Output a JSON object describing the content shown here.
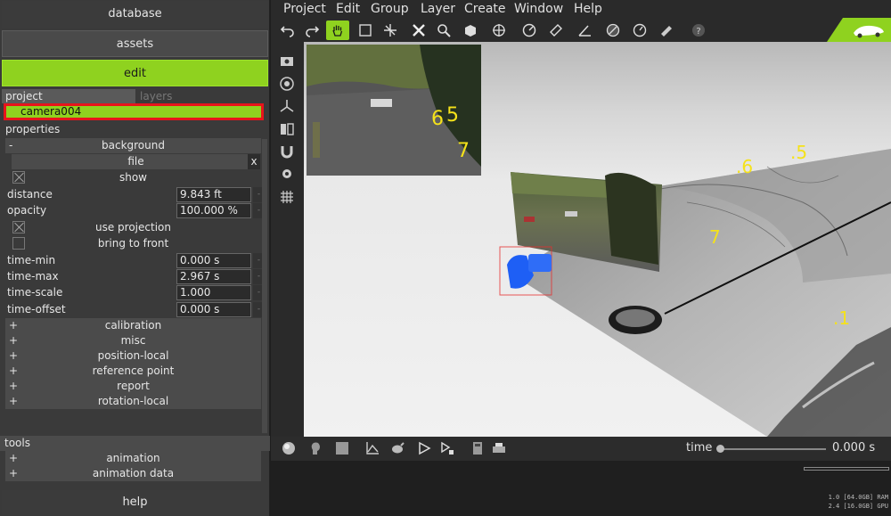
{
  "nav": {
    "database": "database",
    "assets": "assets",
    "edit": "edit"
  },
  "tabs": {
    "project": "project",
    "layers": "layers"
  },
  "project_item": "camera004",
  "properties": {
    "title": "properties",
    "background_section": "background",
    "file_label": "file",
    "file_clear": "x",
    "show": "show",
    "distance_label": "distance",
    "distance_value": "9.843 ft",
    "opacity_label": "opacity",
    "opacity_value": "100.000 %",
    "use_projection": "use projection",
    "bring_to_front": "bring to front",
    "time_min_label": "time-min",
    "time_min_value": "0.000 s",
    "time_max_label": "time-max",
    "time_max_value": "2.967 s",
    "time_scale_label": "time-scale",
    "time_scale_value": "1.000",
    "time_offset_label": "time-offset",
    "time_offset_value": "0.000 s",
    "collapsed_sections": [
      "calibration",
      "misc",
      "position-local",
      "reference point",
      "report",
      "rotation-local"
    ]
  },
  "tools": {
    "title": "tools",
    "sections": [
      "animation",
      "animation data"
    ]
  },
  "help": "help",
  "menu": [
    "Project",
    "Edit",
    "Group",
    "Layer",
    "Create",
    "Window",
    "Help"
  ],
  "toolbar_icons": [
    "undo-icon",
    "redo-icon",
    "hand-icon",
    "select-box-icon",
    "transform-icon",
    "delete-icon",
    "zoom-icon",
    "cube-icon",
    "move-icon",
    "measure-icon",
    "tape-icon",
    "angle-icon",
    "ruler-icon",
    "clock-icon",
    "pen-icon",
    "help-icon"
  ],
  "viewport_labels": {
    "inset_a": "6",
    "inset_b": "5",
    "inset_c": "7",
    "scene_6": ".6",
    "scene_5": ".5",
    "scene_7": "7",
    "scene_1": ".1"
  },
  "time": {
    "label": "time",
    "value": "0.000 s"
  },
  "stats": {
    "line1": "1.0 [64.0GB] RAM",
    "line2": "2.4 [16.0GB] GPU"
  },
  "colors": {
    "accent": "#8fd21f",
    "selection_border": "#e8141b",
    "label_yellow": "#f5e21a"
  }
}
